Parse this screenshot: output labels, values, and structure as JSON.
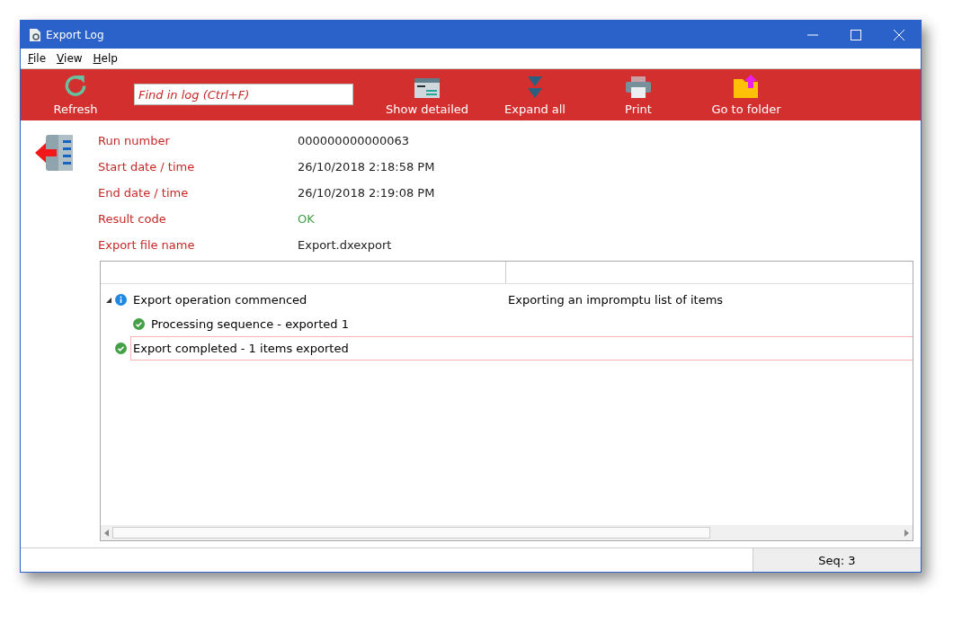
{
  "window": {
    "title": "Export Log"
  },
  "menu": [
    "File",
    "View",
    "Help"
  ],
  "toolbar": {
    "search": {
      "placeholder": "Find in log (Ctrl+F)"
    },
    "buttons": [
      {
        "kind": "refresh",
        "label": "Refresh"
      },
      {
        "kind": "detail",
        "label": "Show detailed"
      },
      {
        "kind": "expand",
        "label": "Expand all"
      },
      {
        "kind": "print",
        "label": "Print"
      },
      {
        "kind": "folder",
        "label": "Go to folder"
      }
    ]
  },
  "details": [
    {
      "label": "Run number",
      "value": "000000000000063",
      "kind": "plain"
    },
    {
      "label": "Start date / time",
      "value": "26/10/2018 2:18:58 PM",
      "kind": "plain"
    },
    {
      "label": "End date / time",
      "value": "26/10/2018 2:19:08 PM",
      "kind": "plain"
    },
    {
      "label": "Result code",
      "value": "OK",
      "kind": "success"
    },
    {
      "label": "Export file name",
      "value": "Export.dxexport",
      "kind": "plain"
    }
  ],
  "log": [
    {
      "kind": "info",
      "text": "Export operation commenced",
      "detail": "Exporting an impromptu list of items",
      "expanded": true,
      "selected": false,
      "children": [
        {
          "kind": "success",
          "text": "Processing sequence - exported 1",
          "selected": false
        }
      ]
    },
    {
      "kind": "success",
      "text": "Export completed - 1 items exported",
      "selected": true
    }
  ],
  "status_bar": {
    "seq": "Seq: 3"
  }
}
